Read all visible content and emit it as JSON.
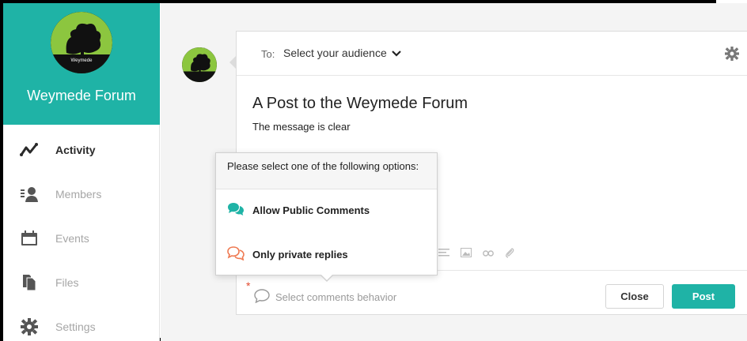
{
  "sidebar": {
    "forum_name": "Weymede Forum",
    "logo_text": "Weymede",
    "nav": [
      {
        "label": "Activity",
        "icon": "activity-icon",
        "active": true
      },
      {
        "label": "Members",
        "icon": "members-icon",
        "active": false
      },
      {
        "label": "Events",
        "icon": "calendar-icon",
        "active": false
      },
      {
        "label": "Files",
        "icon": "files-icon",
        "active": false
      },
      {
        "label": "Settings",
        "icon": "gear-icon",
        "active": false
      }
    ]
  },
  "composer": {
    "to_label": "To:",
    "audience_placeholder": "Select your audience",
    "title": "A Post to the Weymede Forum",
    "body": "The message is clear",
    "comments_placeholder": "Select comments behavior",
    "required_mark": "*",
    "close_label": "Close",
    "post_label": "Post"
  },
  "popover": {
    "heading": "Please select one of the following options:",
    "options": [
      {
        "label": "Allow Public Comments",
        "icon": "speech-bubbles-icon",
        "color": "#1fb3a6"
      },
      {
        "label": "Only private replies",
        "icon": "speech-bubbles-outline-icon",
        "color": "#ef7a52"
      }
    ]
  },
  "colors": {
    "accent": "#1fb3a6",
    "warning": "#e2492f"
  }
}
